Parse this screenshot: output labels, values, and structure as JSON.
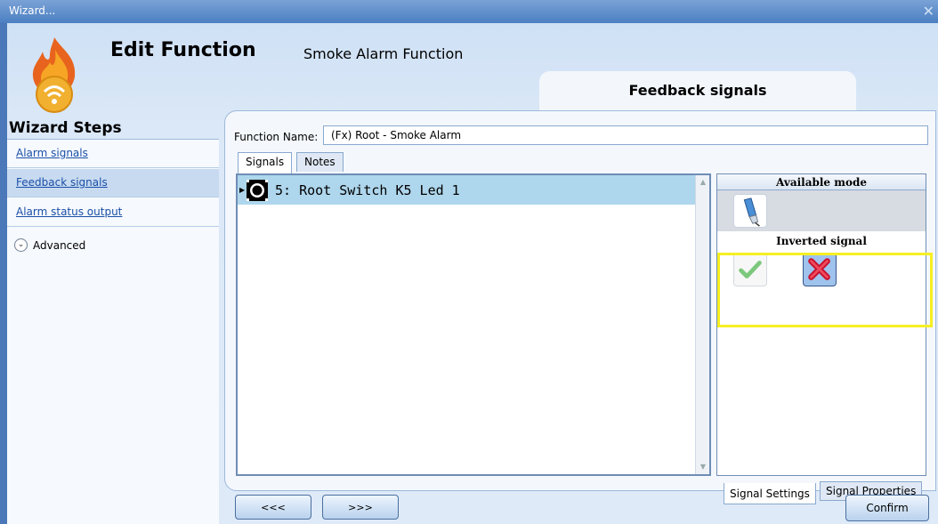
{
  "window": {
    "title": "Wizard...",
    "close_glyph": "✕"
  },
  "header": {
    "title": "Edit Function",
    "subtitle": "Smoke Alarm Function",
    "current_step": "Feedback signals"
  },
  "sidebar": {
    "title": "Wizard Steps",
    "items": [
      {
        "label": "Alarm signals",
        "active": false
      },
      {
        "label": "Feedback signals",
        "active": true
      },
      {
        "label": "Alarm status output",
        "active": false
      }
    ],
    "advanced_label": "Advanced"
  },
  "form": {
    "function_name_label": "Function Name:",
    "function_name_value": "(Fx) Root - Smoke Alarm"
  },
  "tabs": [
    "Signals",
    "Notes"
  ],
  "signals": [
    {
      "label": "5: Root Switch K5 Led 1"
    }
  ],
  "right_panel": {
    "available_mode_title": "Available mode",
    "inverted_signal_title": "Inverted signal",
    "highlight_color": "#f6ef22",
    "tabs": [
      "Signal Settings",
      "Signal Properties"
    ]
  },
  "footer": {
    "prev_label": "<<<",
    "next_label": ">>>",
    "confirm_label": "Confirm"
  }
}
